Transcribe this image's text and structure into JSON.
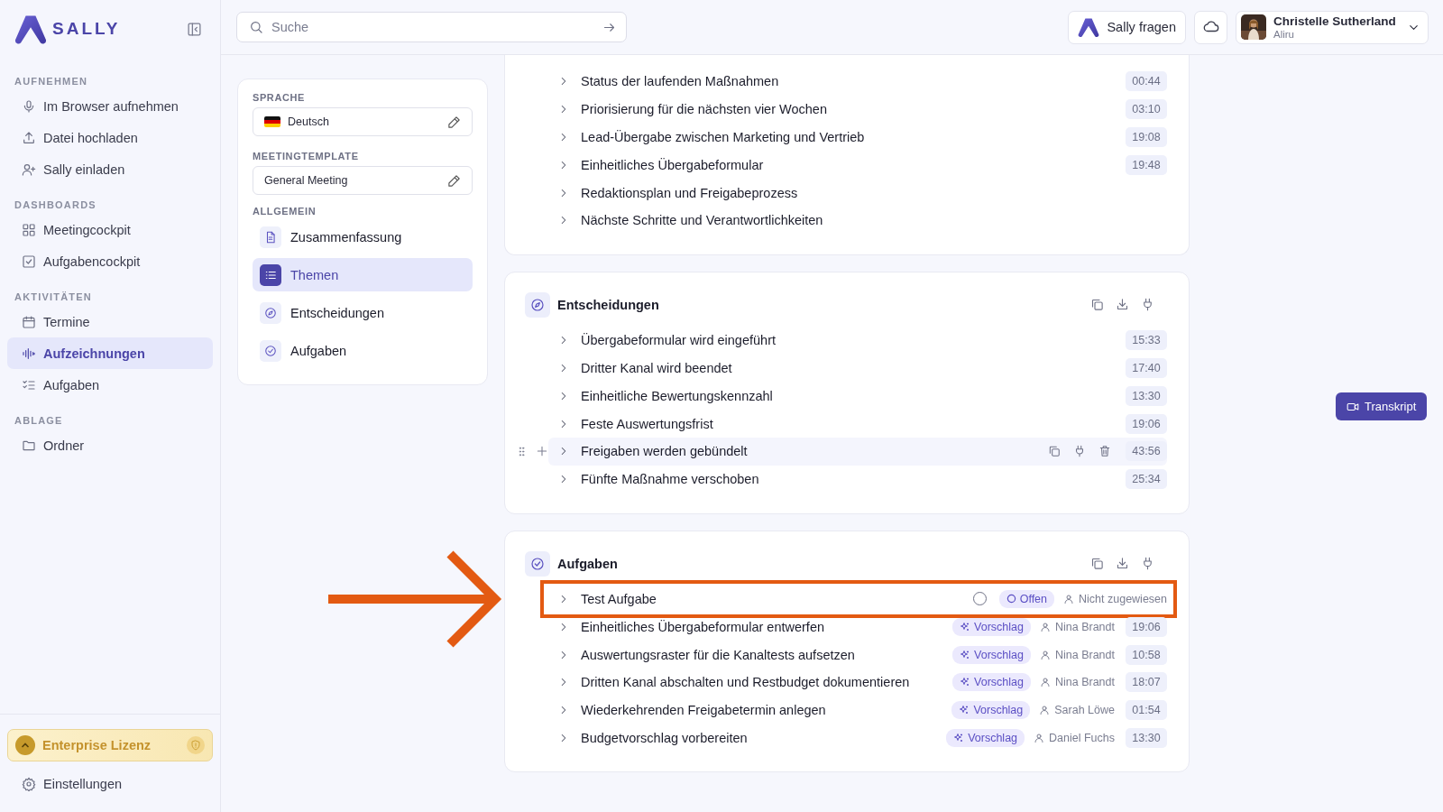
{
  "sidebar": {
    "logo": "SALLY",
    "sections": [
      {
        "title": "AUFNEHMEN",
        "items": [
          {
            "label": "Im Browser aufnehmen",
            "selected": false
          },
          {
            "label": "Datei hochladen",
            "selected": false
          },
          {
            "label": "Sally einladen",
            "selected": false
          }
        ]
      },
      {
        "title": "DASHBOARDS",
        "items": [
          {
            "label": "Meetingcockpit",
            "selected": false
          },
          {
            "label": "Aufgabencockpit",
            "selected": false
          }
        ]
      },
      {
        "title": "AKTIVITÄTEN",
        "items": [
          {
            "label": "Termine",
            "selected": false
          },
          {
            "label": "Aufzeichnungen",
            "selected": true
          },
          {
            "label": "Aufgaben",
            "selected": false
          }
        ]
      },
      {
        "title": "ABLAGE",
        "items": [
          {
            "label": "Ordner",
            "selected": false
          }
        ]
      }
    ],
    "license": "Enterprise Lizenz",
    "settings": "Einstellungen"
  },
  "topbar": {
    "search": {
      "placeholder": "Suche"
    },
    "ask_button": "Sally fragen",
    "user": {
      "name": "Christelle Sutherland",
      "org": "Aliru"
    }
  },
  "settings_panel": {
    "language": {
      "label": "SPRACHE",
      "value": "Deutsch"
    },
    "template": {
      "label": "MEETINGTEMPLATE",
      "value": "General Meeting"
    },
    "general": {
      "label": "ALLGEMEIN",
      "items": [
        {
          "label": "Zusammenfassung",
          "selected": false
        },
        {
          "label": "Themen",
          "selected": true
        },
        {
          "label": "Entscheidungen",
          "selected": false
        },
        {
          "label": "Aufgaben",
          "selected": false
        }
      ]
    }
  },
  "sections": [
    {
      "kind": "topics",
      "rows": [
        {
          "title": "Status der laufenden Maßnahmen",
          "time": "00:44"
        },
        {
          "title": "Priorisierung für die nächsten vier Wochen",
          "time": "03:10"
        },
        {
          "title": "Lead-Übergabe zwischen Marketing und Vertrieb",
          "time": "19:08"
        },
        {
          "title": "Einheitliches Übergabeformular",
          "time": "19:48"
        },
        {
          "title": "Redaktionsplan und Freigabeprozess"
        },
        {
          "title": "Nächste Schritte und Verantwortlichkeiten"
        }
      ]
    },
    {
      "kind": "decisions",
      "title": "Entscheidungen",
      "rows": [
        {
          "title": "Übergabeformular wird eingeführt",
          "time": "15:33",
          "hovered": false
        },
        {
          "title": "Dritter Kanal wird beendet",
          "time": "17:40",
          "hovered": false
        },
        {
          "title": "Einheitliche Bewertungskennzahl",
          "time": "13:30",
          "hovered": false
        },
        {
          "title": "Feste Auswertungsfrist",
          "time": "19:06",
          "hovered": false
        },
        {
          "title": "Freigaben werden gebündelt",
          "time": "43:56",
          "hovered": true
        },
        {
          "title": "Fünfte Maßnahme verschoben",
          "time": "25:34",
          "hovered": false
        }
      ]
    },
    {
      "kind": "tasks",
      "title": "Aufgaben",
      "rows": [
        {
          "title": "Test Aufgabe",
          "checkbox": {
            "checked": false
          },
          "status": {
            "kind": "open",
            "label": "Offen"
          },
          "assignee": "Nicht zugewiesen",
          "annotated": true
        },
        {
          "title": "Einheitliches Übergabeformular entwerfen",
          "status": {
            "kind": "suggestion",
            "label": "Vorschlag"
          },
          "assignee": "Nina Brandt",
          "time": "19:06",
          "annotated": false
        },
        {
          "title": "Auswertungsraster für die Kanaltests aufsetzen",
          "status": {
            "kind": "suggestion",
            "label": "Vorschlag"
          },
          "assignee": "Nina Brandt",
          "time": "10:58",
          "annotated": false
        },
        {
          "title": "Dritten Kanal abschalten und Restbudget dokumentieren",
          "status": {
            "kind": "suggestion",
            "label": "Vorschlag"
          },
          "assignee": "Nina Brandt",
          "time": "18:07",
          "annotated": false
        },
        {
          "title": "Wiederkehrenden Freigabetermin anlegen",
          "status": {
            "kind": "suggestion",
            "label": "Vorschlag"
          },
          "assignee": "Sarah Löwe",
          "time": "01:54",
          "annotated": false
        },
        {
          "title": "Budgetvorschlag vorbereiten",
          "status": {
            "kind": "suggestion",
            "label": "Vorschlag"
          },
          "assignee": "Daniel Fuchs",
          "time": "13:30",
          "annotated": false
        }
      ]
    }
  ],
  "transcript_button": "Transkript"
}
